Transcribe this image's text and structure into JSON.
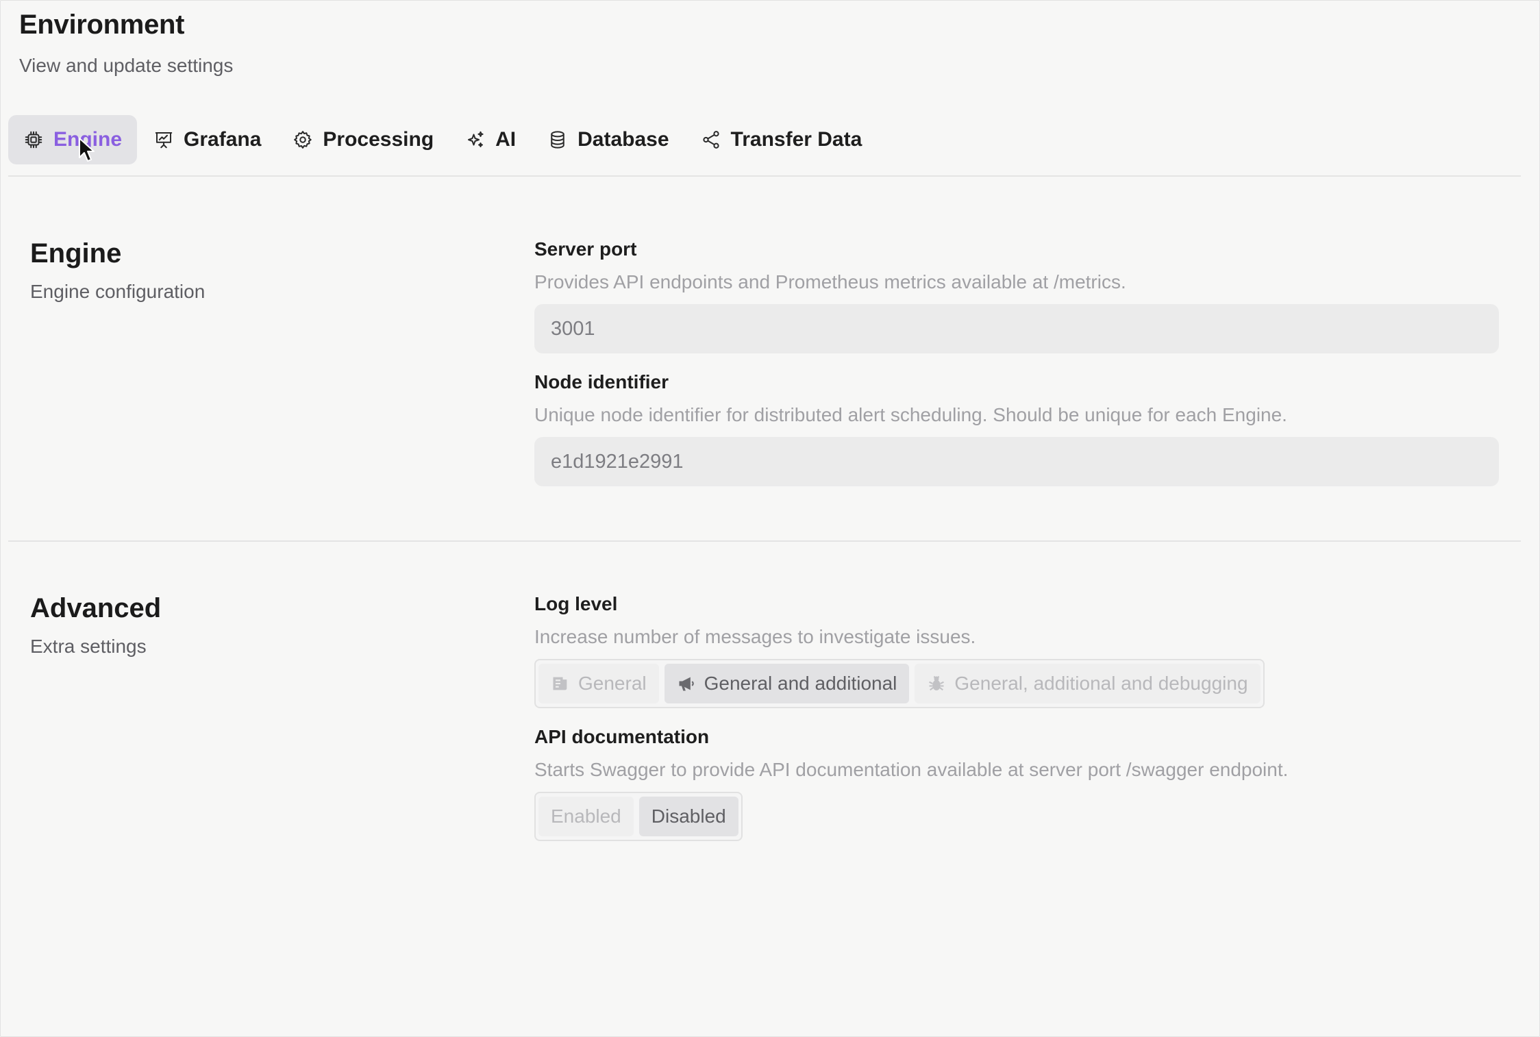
{
  "header": {
    "title": "Environment",
    "subtitle": "View and update settings"
  },
  "tabs": [
    {
      "label": "Engine",
      "icon": "cpu-icon",
      "active": true
    },
    {
      "label": "Grafana",
      "icon": "presentation-chart-icon",
      "active": false
    },
    {
      "label": "Processing",
      "icon": "gear-icon",
      "active": false
    },
    {
      "label": "AI",
      "icon": "sparkles-icon",
      "active": false
    },
    {
      "label": "Database",
      "icon": "database-icon",
      "active": false
    },
    {
      "label": "Transfer Data",
      "icon": "share-icon",
      "active": false
    }
  ],
  "sections": {
    "engine": {
      "title": "Engine",
      "description": "Engine configuration",
      "server_port": {
        "label": "Server port",
        "help": "Provides API endpoints and Prometheus metrics available at /metrics.",
        "value": "3001"
      },
      "node_identifier": {
        "label": "Node identifier",
        "help": "Unique node identifier for distributed alert scheduling. Should be unique for each Engine.",
        "value": "e1d1921e2991"
      }
    },
    "advanced": {
      "title": "Advanced",
      "description": "Extra settings",
      "log_level": {
        "label": "Log level",
        "help": "Increase number of messages to investigate issues.",
        "options": [
          {
            "label": "General",
            "icon": "document-icon",
            "selected": false
          },
          {
            "label": "General and additional",
            "icon": "megaphone-icon",
            "selected": true
          },
          {
            "label": "General, additional and debugging",
            "icon": "bug-icon",
            "selected": false
          }
        ]
      },
      "api_docs": {
        "label": "API documentation",
        "help": "Starts Swagger to provide API documentation available at server port /swagger endpoint.",
        "options": [
          {
            "label": "Enabled",
            "selected": false
          },
          {
            "label": "Disabled",
            "selected": true
          }
        ]
      }
    }
  },
  "colors": {
    "accent": "#8a5fe0",
    "background": "#f7f7f6"
  }
}
